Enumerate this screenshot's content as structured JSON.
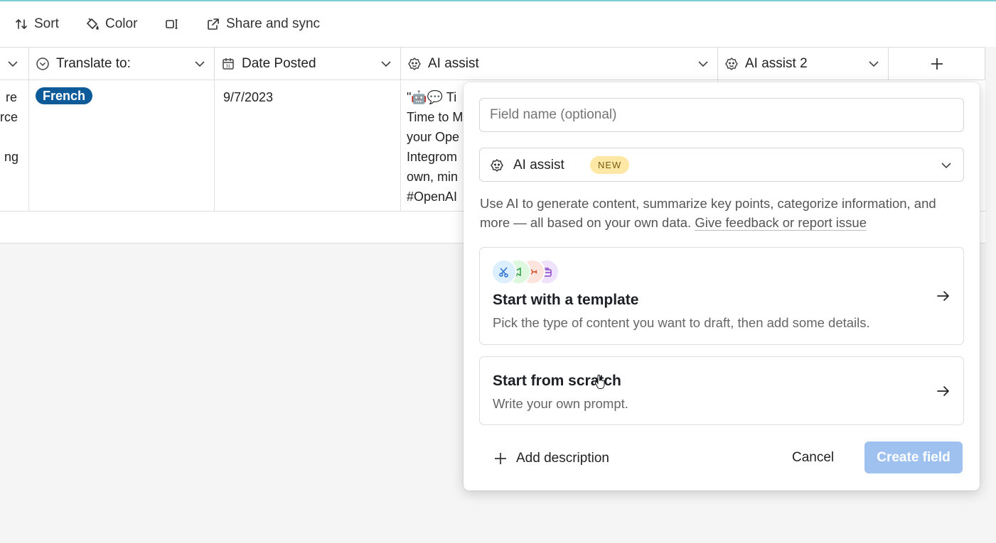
{
  "toolbar": {
    "sort_label": "Sort",
    "color_label": "Color",
    "share_label": "Share and sync"
  },
  "columns": [
    {
      "label": ""
    },
    {
      "label": "Translate to:"
    },
    {
      "label": "Date Posted"
    },
    {
      "label": "AI assist"
    },
    {
      "label": "AI assist 2"
    }
  ],
  "row": {
    "col0_lines": [
      "re",
      "rce",
      "",
      "ng"
    ],
    "translate_to": "French",
    "date_posted": "9/7/2023",
    "ai_assist_lines": [
      "\"🤖💬 Ti",
      "Time to M",
      "your Ope",
      "Integrom",
      "own, min",
      "#OpenAI"
    ]
  },
  "dialog": {
    "field_name_placeholder": "Field name (optional)",
    "field_type_label": "AI assist",
    "field_type_badge": "NEW",
    "description": "Use AI to generate content, summarize key points, categorize information, and more — all based on your own data.",
    "feedback_link": "Give feedback or report issue",
    "template_card": {
      "title": "Start with a template",
      "subtitle": "Pick the type of content you want to draft, then add some details."
    },
    "scratch_card": {
      "title": "Start from scratch",
      "subtitle": "Write your own prompt."
    },
    "add_description_label": "Add description",
    "cancel_label": "Cancel",
    "create_label": "Create field"
  },
  "colors": {
    "accent_pill": "#0d5c99",
    "create_button": "#9ec1f0",
    "badge_bg": "#fde8a6"
  }
}
